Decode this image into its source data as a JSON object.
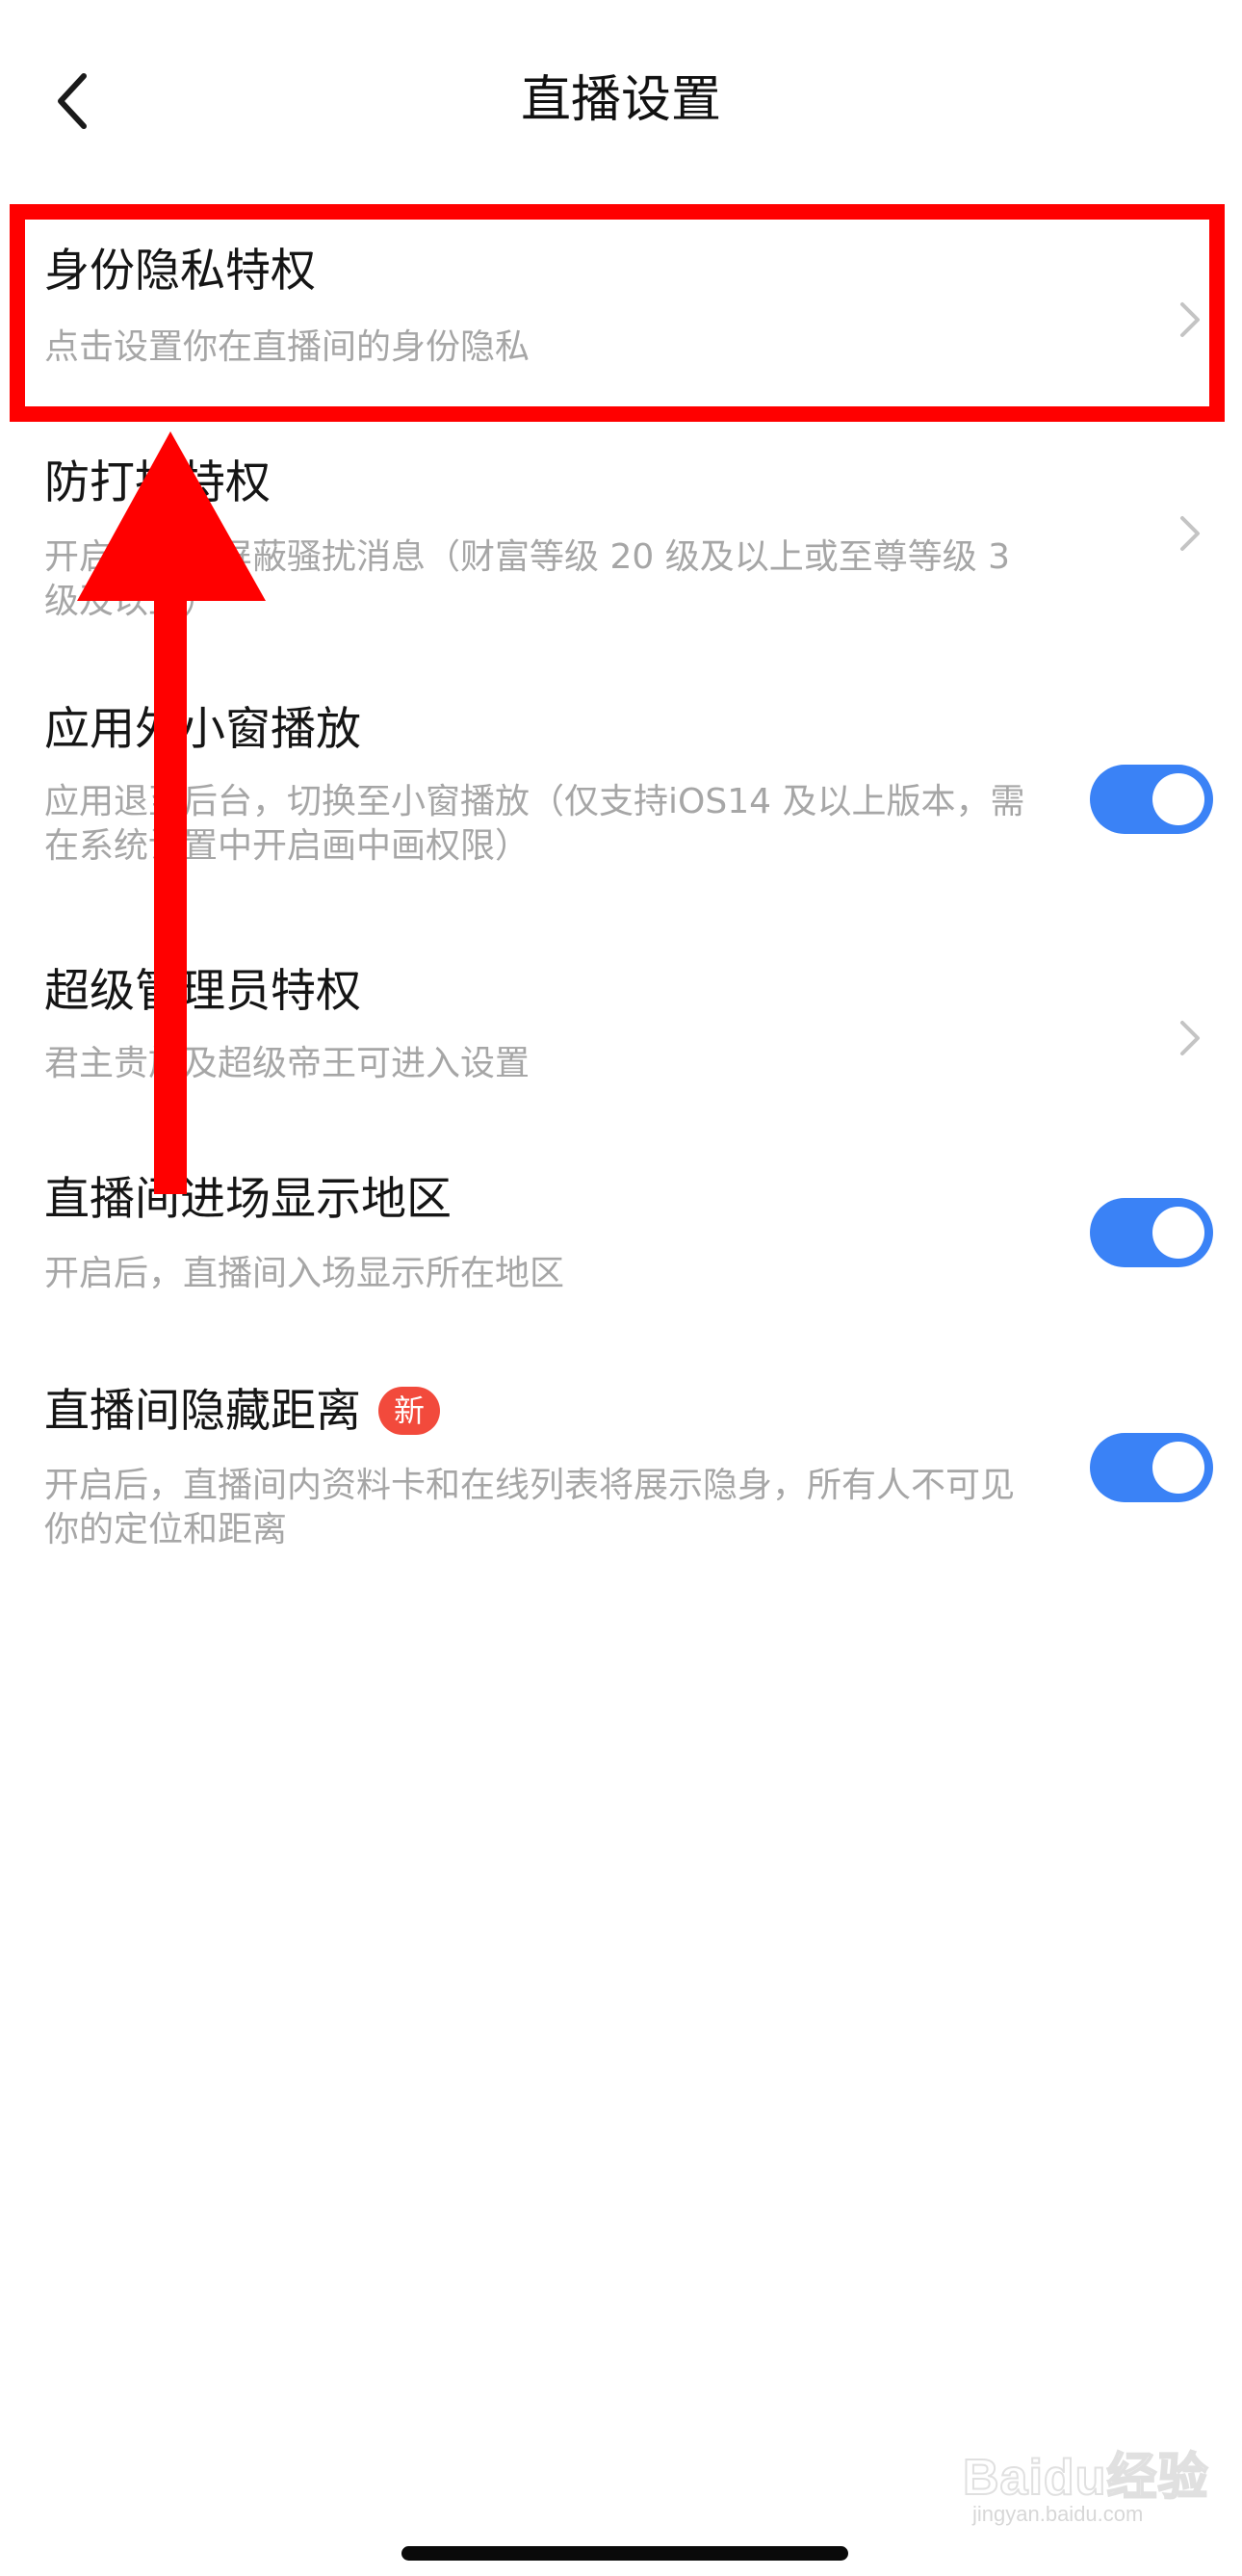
{
  "header": {
    "title": "直播设置",
    "back_icon": "chevron-left-icon"
  },
  "settings": [
    {
      "title": "身份隐私特权",
      "description": "点击设置你在直播间的身份隐私",
      "control": "chevron"
    },
    {
      "title": "防打扰特权",
      "description": "开启后可以屏蔽骚扰消息（财富等级 20 级及以上或至尊等级 3 级及以上）",
      "control": "chevron"
    },
    {
      "title": "应用外小窗播放",
      "description": "应用退至后台，切换至小窗播放（仅支持iOS14 及以上版本，需在系统设置中开启画中画权限）",
      "control": "toggle",
      "enabled": true
    },
    {
      "title": "超级管理员特权",
      "description": "君主贵族及超级帝王可进入设置",
      "control": "chevron"
    },
    {
      "title": "直播间进场显示地区",
      "description": "开启后，直播间入场显示所在地区",
      "control": "toggle",
      "enabled": true
    },
    {
      "title": "直播间隐藏距离",
      "badge": "新",
      "description": "开启后，直播间内资料卡和在线列表将展示隐身，所有人不可见你的定位和距离",
      "control": "toggle",
      "enabled": true
    }
  ],
  "watermark": {
    "logo": "Baidu经验",
    "site": "jingyan.baidu.com"
  },
  "colors": {
    "toggle_on": "#3a82f6",
    "badge": "#f24a3c",
    "annotation": "#ff0000",
    "chevron": "#c4c4c4"
  }
}
